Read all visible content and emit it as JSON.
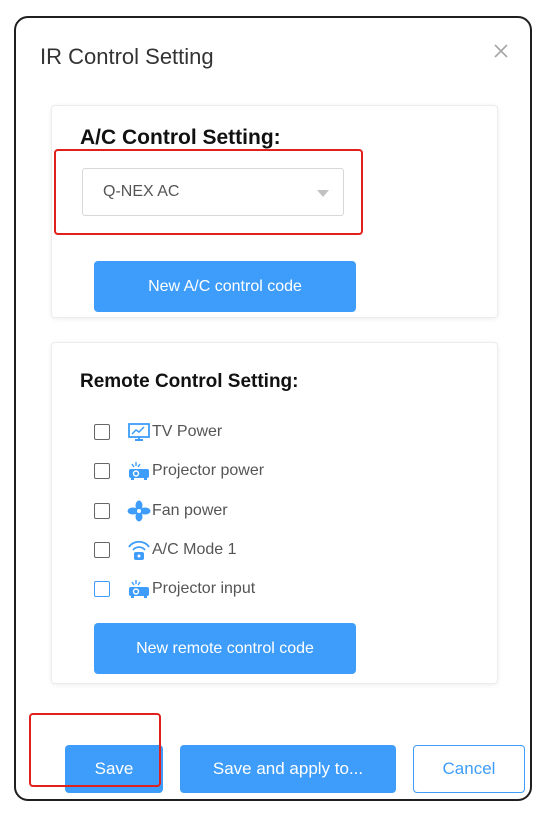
{
  "dialog": {
    "title": "IR Control Setting",
    "close_icon": "close-icon"
  },
  "ac_section": {
    "heading": "A/C Control Setting:",
    "select_value": "Q-NEX AC",
    "new_button": "New A/C control code"
  },
  "remote_section": {
    "heading": "Remote Control Setting:",
    "items": [
      {
        "label": "TV Power",
        "icon": "tv-icon",
        "checked": false
      },
      {
        "label": "Projector power",
        "icon": "projector-icon",
        "checked": false
      },
      {
        "label": "Fan power",
        "icon": "fan-icon",
        "checked": false
      },
      {
        "label": "A/C Mode 1",
        "icon": "air-conditioner-icon",
        "checked": false
      },
      {
        "label": "Projector input",
        "icon": "projector-icon",
        "checked": false
      }
    ],
    "new_button": "New remote control code"
  },
  "footer": {
    "save": "Save",
    "save_apply": "Save and apply to...",
    "cancel": "Cancel"
  },
  "colors": {
    "accent": "#3e9dfb",
    "highlight": "#e0201c",
    "icon_blue": "#3e9dfb"
  }
}
